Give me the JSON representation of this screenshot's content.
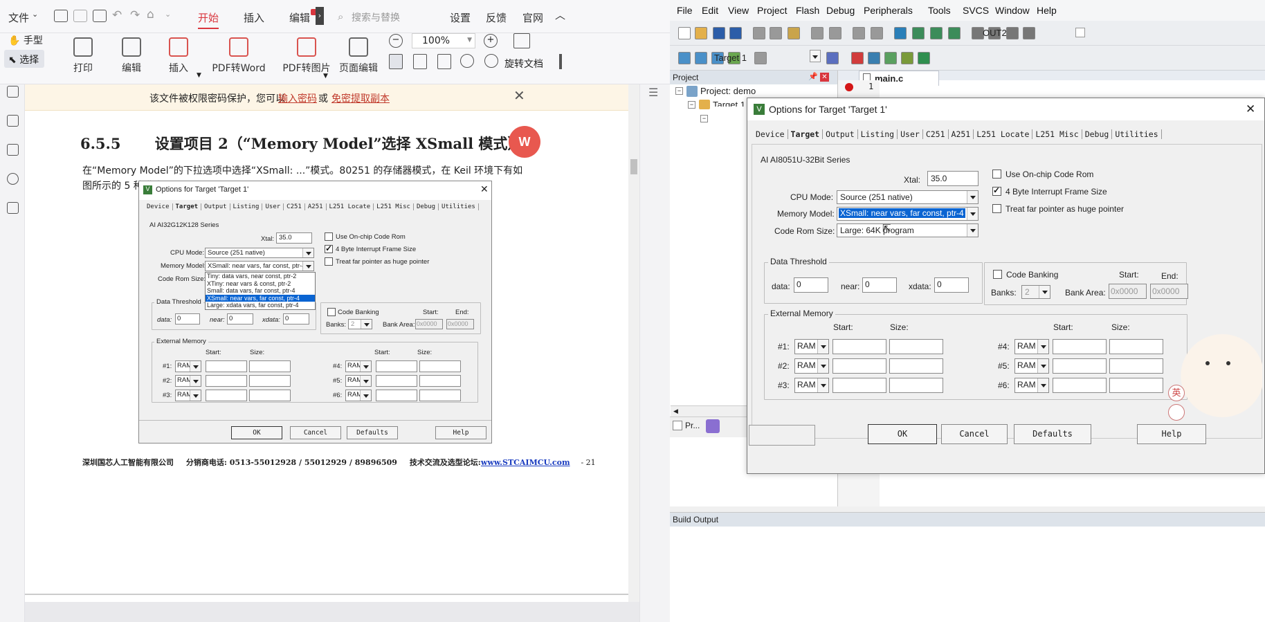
{
  "pdf_reader": {
    "menu": {
      "file": "文件",
      "start": "开始",
      "insert": "插入",
      "edit": "编辑",
      "search_placeholder": "搜索与替换",
      "settings": "设置",
      "feedback": "反馈",
      "website": "官网"
    },
    "toolbar": {
      "hand": "手型",
      "select": "选择",
      "print": "打印",
      "edit": "编辑",
      "insert": "插入",
      "pdf_to_word": "PDF转Word",
      "pdf_to_image": "PDF转图片",
      "page_edit": "页面编辑",
      "zoom": "100%",
      "rotate": "旋转文档"
    },
    "banner": {
      "text": "该文件被权限密码保护，您可以",
      "link1": "输入密码",
      "or": "或",
      "link2": "免密提取副本"
    },
    "doc": {
      "heading_num": "6.5.5",
      "heading": "设置项目 2（“Memory Model”选择 XSmall 模式）",
      "para_line1": "在“Memory Model”的下拉选项中选择“XSmall: ...”模式。80251 的存储器模式，在 Keil 环境下有如",
      "para_line2": "图所示的 5 种模式:",
      "footer_company": "深圳国芯人工智能有限公司",
      "footer_phone": "分销商电话: 0513-55012928 / 55012929 / 89896509",
      "footer_forum": "技术交流及选型论坛:",
      "footer_url": "www.STCAIMCU.com",
      "footer_page": "- 21"
    },
    "figure": {
      "title": "Options for Target 'Target 1'",
      "tabs": [
        "Device",
        "Target",
        "Output",
        "Listing",
        "User",
        "C251",
        "A251",
        "L251 Locate",
        "L251 Misc",
        "Debug",
        "Utilities"
      ],
      "series": "AI AI32G12K128 Series",
      "xtal_label": "Xtal:",
      "xtal": "35.0",
      "cpu_mode_label": "CPU Mode:",
      "cpu_mode": "Source (251 native)",
      "memory_model_label": "Memory Model:",
      "memory_model": "XSmall: near vars, far const, ptr-4",
      "code_rom_label": "Code Rom Size:",
      "options": [
        "Tiny: data vars, near const, ptr-2",
        "XTiny: near vars & const, ptr-2",
        "Small: data vars, far const, ptr-4",
        "XSmall: near vars, far const, ptr-4",
        "Large: xdata vars, far const, ptr-4"
      ],
      "use_onchip": "Use On-chip Code Rom",
      "four_byte": "4 Byte Interrupt Frame Size",
      "treat_far": "Treat far pointer as huge pointer",
      "data_threshold": "Data Threshold",
      "data_label": "data:",
      "near_label": "near:",
      "xdata_label": "xdata:",
      "zero": "0",
      "code_banking": "Code Banking",
      "start": "Start:",
      "end": "End:",
      "banks": "Banks:",
      "banks_val": "2",
      "bank_area": "Bank Area:",
      "hex": "0x0000",
      "ext_mem": "External Memory",
      "size": "Size:",
      "ram": "RAM",
      "rows_left": [
        "#1:",
        "#2:",
        "#3:"
      ],
      "rows_right": [
        "#4:",
        "#5:",
        "#6:"
      ],
      "ok": "OK",
      "cancel": "Cancel",
      "defaults": "Defaults",
      "help": "Help"
    }
  },
  "keil": {
    "menu": [
      "File",
      "Edit",
      "View",
      "Project",
      "Flash",
      "Debug",
      "Peripherals",
      "Tools",
      "SVCS",
      "Window",
      "Help"
    ],
    "toolbar": {
      "out": "OUT2",
      "target": "Target 1"
    },
    "project": {
      "header": "Project",
      "root": "Project: demo",
      "target": "Target 1",
      "tab": "Pr..."
    },
    "editor": {
      "tab": "main.c",
      "line": "1"
    },
    "build": "Build Output",
    "dialog": {
      "title": "Options for Target 'Target 1'",
      "tabs": [
        "Device",
        "Target",
        "Output",
        "Listing",
        "User",
        "C251",
        "A251",
        "L251 Locate",
        "L251 Misc",
        "Debug",
        "Utilities"
      ],
      "series": "AI AI8051U-32Bit Series",
      "xtal_label": "Xtal:",
      "xtal": "35.0",
      "cpu_mode_label": "CPU Mode:",
      "cpu_mode": "Source (251 native)",
      "memory_model_label": "Memory Model:",
      "memory_model": "XSmall: near vars, far const, ptr-4",
      "code_rom_label": "Code Rom Size:",
      "code_rom": "Large: 64K program",
      "use_onchip": "Use On-chip Code Rom",
      "four_byte": "4 Byte Interrupt Frame Size",
      "treat_far": "Treat far pointer as huge pointer",
      "data_threshold": "Data Threshold",
      "data_label": "data:",
      "near_label": "near:",
      "xdata_label": "xdata:",
      "zero": "0",
      "code_banking": "Code Banking",
      "start": "Start:",
      "end": "End:",
      "banks": "Banks:",
      "banks_val": "2",
      "bank_area": "Bank Area:",
      "hex": "0x0000",
      "ext_mem": "External Memory",
      "size": "Size:",
      "ram": "RAM",
      "rows_left": [
        "#1:",
        "#2:",
        "#3:"
      ],
      "rows_right": [
        "#4:",
        "#5:",
        "#6:"
      ],
      "ok": "OK",
      "cancel": "Cancel",
      "defaults": "Defaults",
      "help": "Help",
      "sticker": "英"
    }
  },
  "colors": {
    "accent_red": "#d9363e",
    "keil_select": "#0a64d2",
    "link": "#c0392b"
  }
}
